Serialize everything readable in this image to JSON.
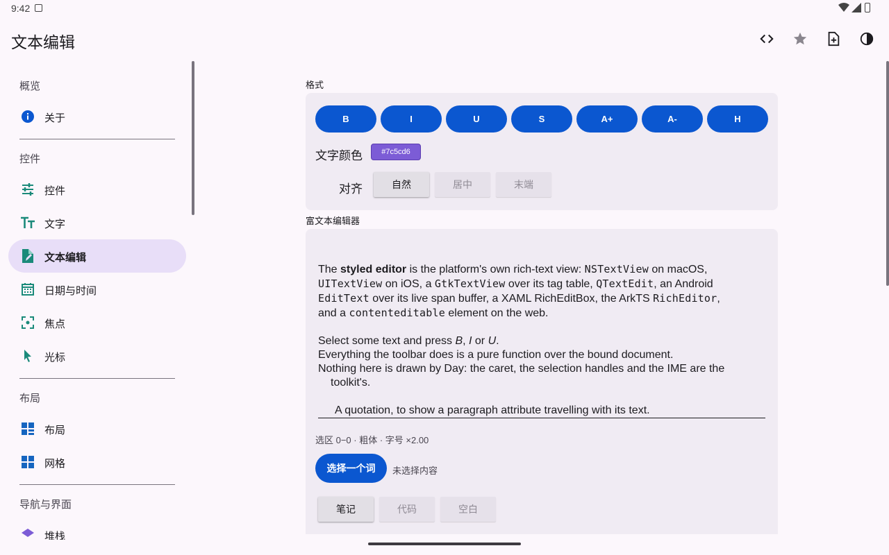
{
  "status": {
    "time": "9:42"
  },
  "appbar": {
    "title": "文本编辑",
    "actions": [
      "code-icon",
      "star-icon",
      "note-add-icon",
      "contrast-icon"
    ]
  },
  "sidebar": {
    "sections": [
      {
        "title": "概览",
        "items": [
          {
            "label": "关于",
            "icon": "info-icon"
          }
        ]
      },
      {
        "title": "控件",
        "items": [
          {
            "label": "控件",
            "icon": "sliders-icon"
          },
          {
            "label": "文字",
            "icon": "text-size-icon"
          },
          {
            "label": "文本编辑",
            "icon": "edit-document-icon",
            "active": true
          },
          {
            "label": "日期与时间",
            "icon": "calendar-icon"
          },
          {
            "label": "焦点",
            "icon": "focus-icon"
          },
          {
            "label": "光标",
            "icon": "cursor-icon"
          }
        ]
      },
      {
        "title": "布局",
        "items": [
          {
            "label": "布局",
            "icon": "layout-icon"
          },
          {
            "label": "网格",
            "icon": "grid-icon"
          }
        ]
      },
      {
        "title": "导航与界面",
        "items": [
          {
            "label": "堆栈",
            "icon": "stack-icon"
          }
        ]
      }
    ]
  },
  "format": {
    "label": "格式",
    "buttons": [
      "B",
      "I",
      "U",
      "S",
      "A+",
      "A-",
      "H"
    ],
    "color_label": "文字颜色",
    "color_value": "#7c5cd6",
    "align_label": "对齐",
    "align_options": [
      "自然",
      "居中",
      "末端"
    ],
    "align_selected": "自然"
  },
  "rich": {
    "label": "富文本编辑器",
    "p1": {
      "t1": "The ",
      "b1": "styled editor",
      "t2": " is the platform's own rich-text view: ",
      "m1": "NSTextView",
      "t3": " on macOS,",
      "m2": "UITextView",
      "t4": " on iOS, a ",
      "m3": "GtkTextView",
      "t5": " over its tag table, ",
      "m4": "QTextEdit",
      "t6": ", an Android",
      "m5": "EditText",
      "t7": " over its live span buffer, a XAML ",
      "t8": "RichEditBox",
      "t9": ", the ArkTS ",
      "m6": "RichEditor",
      "t10": ",",
      "t11": "and a ",
      "m7": "contenteditable",
      "t12": " element on the web."
    },
    "p2": {
      "t1": "Select some text and press ",
      "i1": "B",
      "t2": ", ",
      "i2": "I",
      "t3": " or ",
      "i3": "U",
      "t4": "."
    },
    "p3": "Everything the toolbar does is a pure function over the bound document.",
    "p4a": "Nothing here is drawn by Day: the caret, the selection handles and the IME are the",
    "p4b": "toolkit's.",
    "quote": "A quotation, to show a paragraph attribute travelling with its text.",
    "selection_info": "选区 0−0 · 粗体 · 字号 ×2.00",
    "pick_button": "选择一个词",
    "pick_status": "未选择内容",
    "preset_options": [
      "笔记",
      "代码",
      "空白"
    ],
    "preset_selected": "笔记"
  },
  "colors": {
    "primary": "#0b57d0",
    "nav_active": "#e8def8",
    "card": "#f0ebf3",
    "background": "#fcf7fc"
  }
}
